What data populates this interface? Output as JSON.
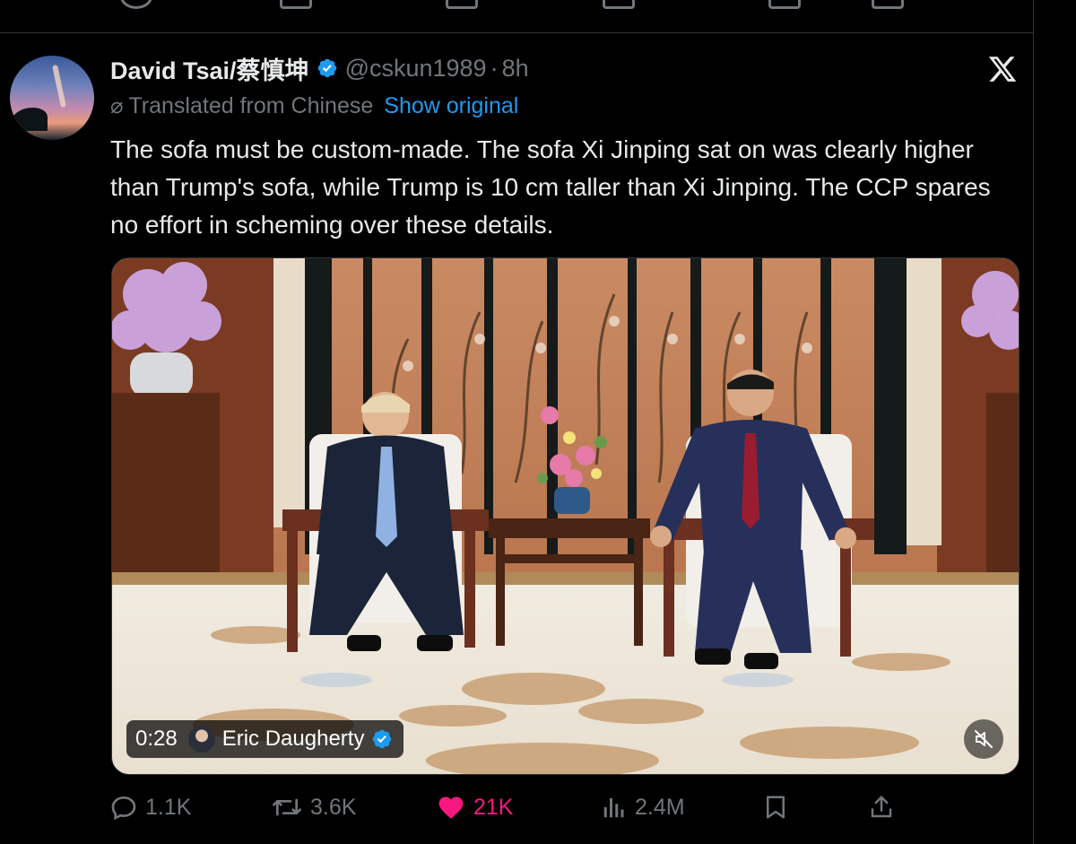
{
  "tweet": {
    "author_name": "David Tsai/蔡慎坤",
    "handle": "@cskun1989",
    "separator": "·",
    "time": "8h",
    "translated_label": "Translated from Chinese",
    "show_original_label": "Show original",
    "text": "The sofa must be custom-made. The sofa Xi Jinping sat on was clearly higher than Trump's sofa, while Trump is 10 cm taller than Xi Jinping. The CCP spares no effort in scheming over these details."
  },
  "video": {
    "timestamp": "0:28",
    "credit_name": "Eric Daugherty"
  },
  "actions": {
    "replies": "1.1K",
    "reposts": "3.6K",
    "likes": "21K",
    "views": "2.4M"
  },
  "colors": {
    "background": "#000000",
    "text": "#e7e9ea",
    "muted": "#71767b",
    "accent_blue": "#1d9bf0",
    "like_pink": "#f91880"
  },
  "icons": [
    "verified-icon",
    "x-logo-icon",
    "translate-icon",
    "mute-icon",
    "reply-icon",
    "repost-icon",
    "like-icon",
    "views-icon",
    "bookmark-icon",
    "share-icon"
  ]
}
